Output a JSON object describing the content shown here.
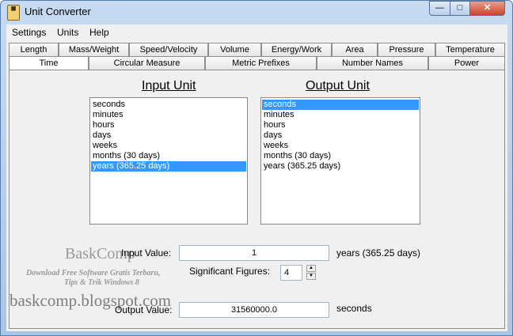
{
  "window": {
    "title": "Unit Converter",
    "icon": "calculator-icon"
  },
  "title_buttons": {
    "minimize": "—",
    "maximize": "□",
    "close": "✕"
  },
  "menu": [
    "Settings",
    "Units",
    "Help"
  ],
  "tabs_row1": [
    "Length",
    "Mass/Weight",
    "Speed/Velocity",
    "Volume",
    "Energy/Work",
    "Area",
    "Pressure",
    "Temperature"
  ],
  "tabs_row2": [
    "Time",
    "Circular Measure",
    "Metric Prefixes",
    "Number Names",
    "Power"
  ],
  "active_tab": "Time",
  "input_unit": {
    "heading": "Input Unit",
    "items": [
      "seconds",
      "minutes",
      "hours",
      "days",
      "weeks",
      "months (30 days)",
      "years (365.25 days)"
    ],
    "selected": "years (365.25 days)"
  },
  "output_unit": {
    "heading": "Output Unit",
    "items": [
      "seconds",
      "minutes",
      "hours",
      "days",
      "weeks",
      "months (30 days)",
      "years (365.25 days)"
    ],
    "selected": "seconds"
  },
  "input_value": {
    "label": "Input Value:",
    "value": "1",
    "unit": "years (365.25 days)"
  },
  "significant_figures": {
    "label": "Significant Figures:",
    "value": "4"
  },
  "output_value": {
    "label": "Output Value:",
    "value": "31560000.0",
    "unit": "seconds"
  },
  "watermark": {
    "title": "BaskComp",
    "line1": "Download Free Software Gratis Terbaru,",
    "line2": "Tips & Trik Windows 8",
    "url": "baskcomp.blogspot.com"
  },
  "colors": {
    "selection": "#3399ff",
    "frame": "#b9d1ea",
    "close": "#c8452c"
  }
}
